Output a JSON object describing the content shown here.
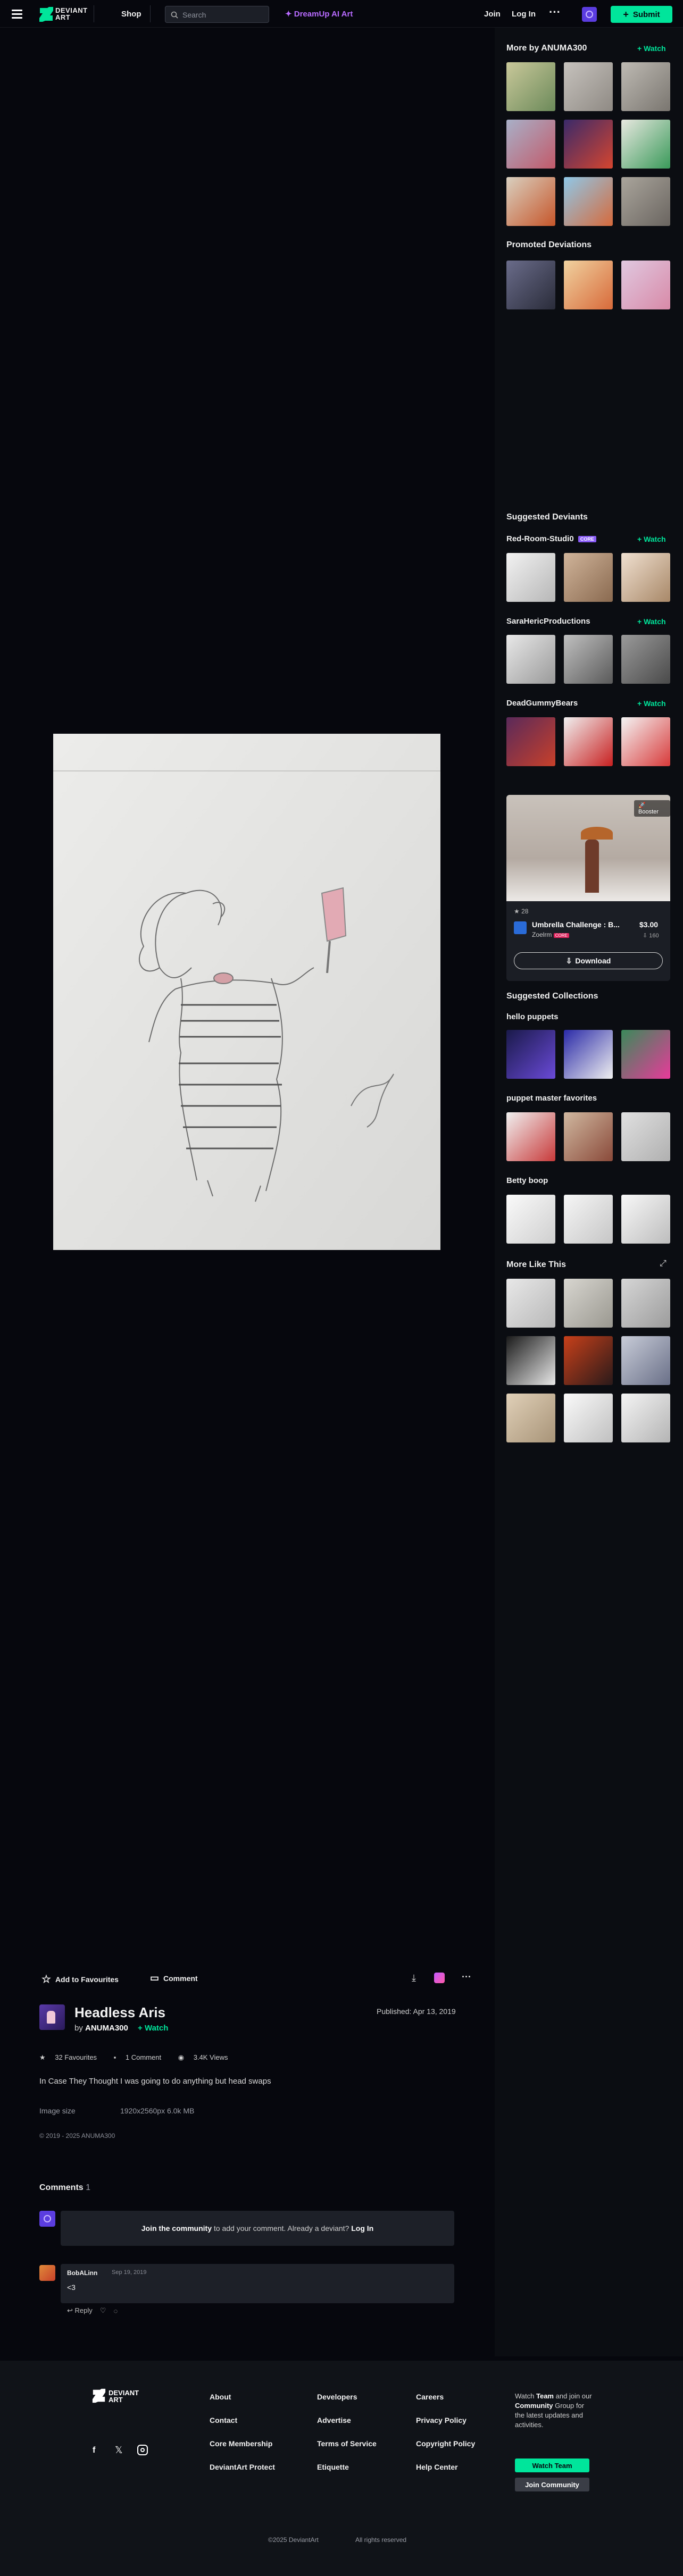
{
  "header": {
    "logo_line1": "DEVIANT",
    "logo_line2": "ART",
    "shop_label": "Shop",
    "search_placeholder": "Search",
    "dreamup_label": "DreamUp AI Art",
    "join_label": "Join",
    "login_label": "Log In",
    "more_label": "···",
    "submit_label": "Submit"
  },
  "colors": {
    "accent": "#00e59b",
    "dreamup": "#b86bff",
    "background": "#06070d",
    "panel": "#0b0d12",
    "core_badge": "#8a5cf6",
    "badge_red": "#e0245e"
  },
  "sidebar": {
    "more_by": "More by ANUMA300",
    "watch_label": "Watch",
    "promoted": "Promoted Deviations",
    "suggested_deviants": "Suggested Deviants",
    "deviant1": "Red-Room-Studi0",
    "deviant1_badge": "CORE",
    "deviant2": "SaraHericProductions",
    "deviant3": "DeadGummyBears",
    "promo": {
      "badge": "Booster",
      "likes": "28",
      "title": "Umbrella Challenge : B...",
      "price": "$3.00",
      "author": "Zoelrm",
      "author_badge": "CORE",
      "count": "160",
      "download_label": "Download"
    },
    "suggested_collections": "Suggested Collections",
    "coll1": "hello puppets",
    "coll2": "puppet master favorites",
    "coll3": "Betty boop",
    "more_like_this": "More Like This"
  },
  "toolbar": {
    "fav_label": "Add to Favourites",
    "comment_label": "Comment"
  },
  "deviation": {
    "title": "Headless Aris",
    "by": "by",
    "author": "ANUMA300",
    "watch_label": "Watch",
    "published": "Published: Apr 13, 2019",
    "favourites": "32 Favourites",
    "comments": "1 Comment",
    "views": "3.4K Views",
    "description": "In Case They Thought I was going to do anything but head swaps",
    "image_size_label": "Image size",
    "image_size_value": "1920x2560px 6.0k MB",
    "copyright": "© 2019 - 2025 ANUMA300"
  },
  "comments": {
    "heading": "Comments",
    "count": "1",
    "join_bold": "Join the community",
    "join_text": " to add your comment. Already a deviant? ",
    "login": "Log In",
    "items": [
      {
        "user": "BobALinn",
        "date": "Sep 19, 2019",
        "text": "<3",
        "reply_label": "Reply"
      }
    ]
  },
  "footer": {
    "logo_line1": "DEVIANT",
    "logo_line2": "ART",
    "col1": [
      "About",
      "Contact",
      "Core Membership",
      "DeviantArt Protect"
    ],
    "col2": [
      "Developers",
      "Advertise",
      "Terms of Service",
      "Etiquette"
    ],
    "col3": [
      "Careers",
      "Privacy Policy",
      "Copyright Policy",
      "Help Center"
    ],
    "promo_watch": "Watch",
    "promo_team": "Team",
    "promo_rest1": "and",
    "promo_rest2": "join our",
    "promo_community": "Community",
    "promo_rest3": "Group for the latest updates and activities.",
    "watch_team_button": "Watch Team",
    "join_community_button": "Join Community",
    "copyright": "©2025 DeviantArt",
    "rights": "All rights reserved"
  }
}
